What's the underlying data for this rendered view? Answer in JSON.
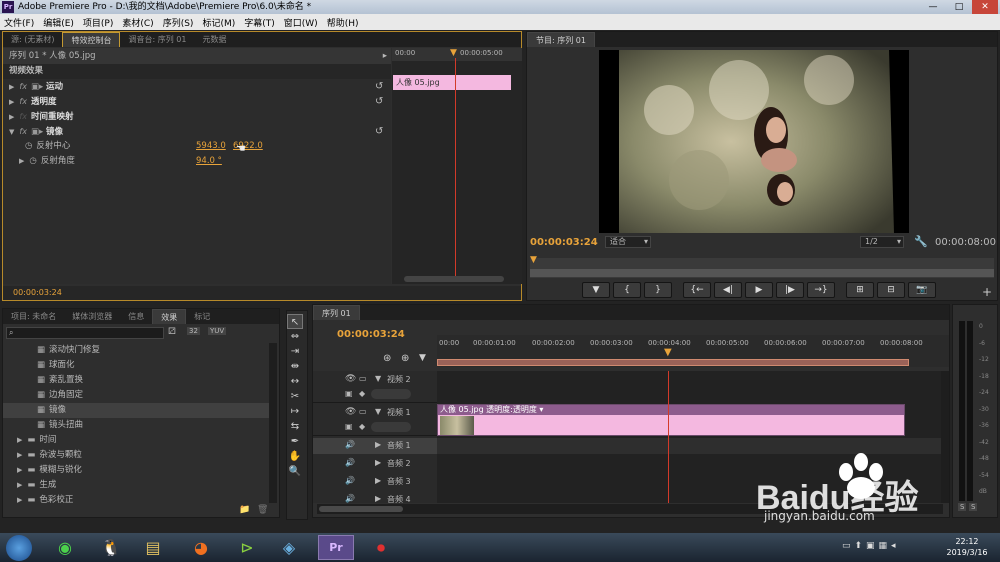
{
  "window": {
    "title": "Adobe Premiere Pro - D:\\我的文档\\Adobe\\Premiere Pro\\6.0\\未命名 *",
    "app_icon": "Pr",
    "min": "—",
    "max": "□",
    "close": "✕"
  },
  "menu": [
    "文件(F)",
    "编辑(E)",
    "项目(P)",
    "素材(C)",
    "序列(S)",
    "标记(M)",
    "字幕(T)",
    "窗口(W)",
    "帮助(H)"
  ],
  "fx_panel": {
    "tabs": [
      "源: (无素材)",
      "特效控制台",
      "调音台: 序列 01",
      "元数据"
    ],
    "header": "序列 01 * 人像 05.jpg",
    "section": "视频效果",
    "effects": [
      {
        "name": "运动"
      },
      {
        "name": "透明度"
      },
      {
        "name": "时间重映射"
      },
      {
        "name": "镜像"
      }
    ],
    "params": [
      {
        "name": "反射中心",
        "v1": "5943.0",
        "v2": "6922.0"
      },
      {
        "name": "反射角度",
        "v1": "94.0 °"
      }
    ],
    "timecode": "00:00:03:24",
    "ruler": [
      "00:00",
      "00:00:05:00"
    ],
    "clip": "人像 05.jpg"
  },
  "program": {
    "tab": "节目: 序列 01",
    "timecode": "00:00:03:24",
    "fit": "适合",
    "scale": "1/2",
    "duration": "00:00:08:00",
    "buttons": [
      "▼",
      "{",
      "}",
      "{←",
      "◀|",
      "▶",
      "|▶",
      "→}",
      "⊞",
      "⊟",
      "📷"
    ]
  },
  "project": {
    "tabs": [
      "项目: 未命名",
      "媒体浏览器",
      "信息",
      "效果",
      "标记"
    ],
    "items": [
      "滚动快门修复",
      "球面化",
      "紊乱置换",
      "边角固定",
      "镜像",
      "镜头扭曲"
    ],
    "folders": [
      "时间",
      "杂波与颗粒",
      "模糊与锐化",
      "生成",
      "色彩校正"
    ]
  },
  "tools": [
    "↖",
    "⇔",
    "⇥",
    "⇹",
    "↔",
    "✂",
    "↦",
    "⇆",
    "✒",
    "✋",
    "🔍"
  ],
  "timeline": {
    "tab": "序列 01",
    "timecode": "00:00:03:24",
    "ruler": [
      "00:00",
      "00:00:01:00",
      "00:00:02:00",
      "00:00:03:00",
      "00:00:04:00",
      "00:00:05:00",
      "00:00:06:00",
      "00:00:07:00",
      "00:00:08:00"
    ],
    "tracks": [
      {
        "name": "视频 2"
      },
      {
        "name": "视频 1"
      },
      {
        "name": "音频 1"
      },
      {
        "name": "音频 2"
      },
      {
        "name": "音频 3"
      },
      {
        "name": "音频 4"
      }
    ],
    "clip_label": "人像 05.jpg  透明度:透明度 ▾"
  },
  "meter": {
    "labels": [
      "0",
      "-6",
      "-12",
      "-18",
      "-24",
      "-30",
      "-36",
      "-42",
      "-48",
      "-54",
      "dB"
    ],
    "solo": [
      "S",
      "S"
    ]
  },
  "taskbar": {
    "time": "22:12",
    "date": "2019/3/16"
  },
  "watermark": {
    "brand": "Baidu经验",
    "url": "jingyan.baidu.com"
  },
  "colors": {
    "accent": "#e8a33a",
    "clip_pink": "#f4b8e0",
    "playhead": "#d23a2a"
  }
}
